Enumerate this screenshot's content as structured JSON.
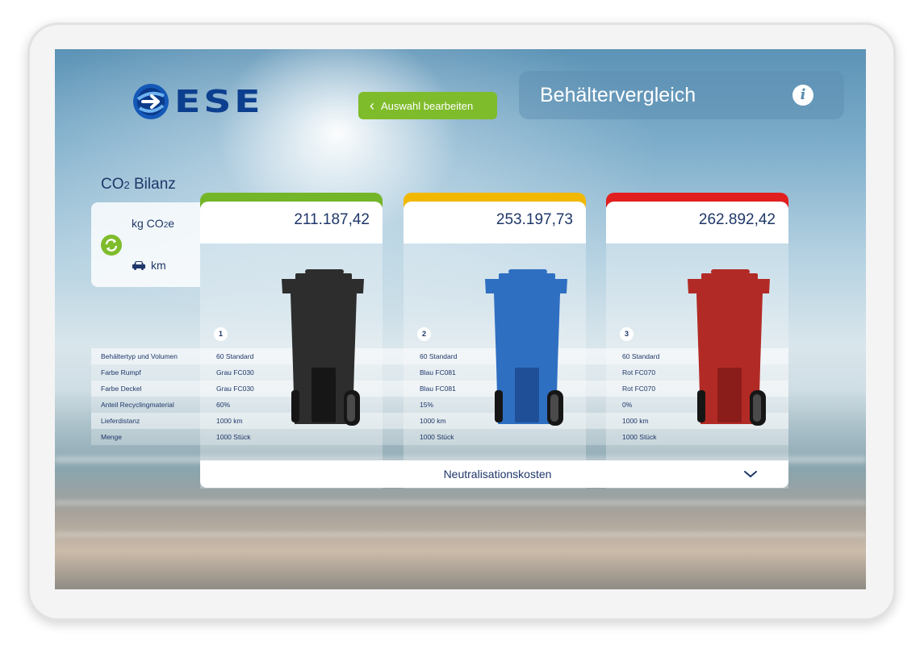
{
  "header": {
    "logo_text": "ESE",
    "back_button_label": "Auswahl bearbeiten",
    "title": "Behältervergleich"
  },
  "summary": {
    "title": "CO2 Bilanz",
    "unit_co2": "kg CO2e",
    "unit_km": "km"
  },
  "rows": [
    "Behältertyp und Volumen",
    "Farbe Rumpf",
    "Farbe Deckel",
    "Anteil Recyclingmaterial",
    "Lieferdistanz",
    "Menge"
  ],
  "containers": [
    {
      "number": "1",
      "value": "211.187,42",
      "accent": "#74b62a",
      "bin_color": "#2d2d2d",
      "cells": [
        "60 Standard",
        "Grau FC030",
        "Grau FC030",
        "60%",
        "1000 km",
        "1000 Stück"
      ]
    },
    {
      "number": "2",
      "value": "253.197,73",
      "accent": "#f2b800",
      "bin_color": "#2f6fc2",
      "cells": [
        "60 Standard",
        "Blau FC081",
        "Blau FC081",
        "15%",
        "1000 km",
        "1000 Stück"
      ]
    },
    {
      "number": "3",
      "value": "262.892,42",
      "accent": "#e11f1f",
      "bin_color": "#b22a25",
      "cells": [
        "60 Standard",
        "Rot FC070",
        "Rot FC070",
        "0%",
        "1000 km",
        "1000 Stück"
      ]
    }
  ],
  "footer": {
    "neutralization_label": "Neutralisationskosten"
  },
  "icons": {
    "logo": "ese-logo-icon",
    "back": "chevron-left-icon",
    "info": "info-icon",
    "toggle": "refresh-toggle-icon",
    "car": "car-icon",
    "expand": "chevron-down-icon"
  }
}
